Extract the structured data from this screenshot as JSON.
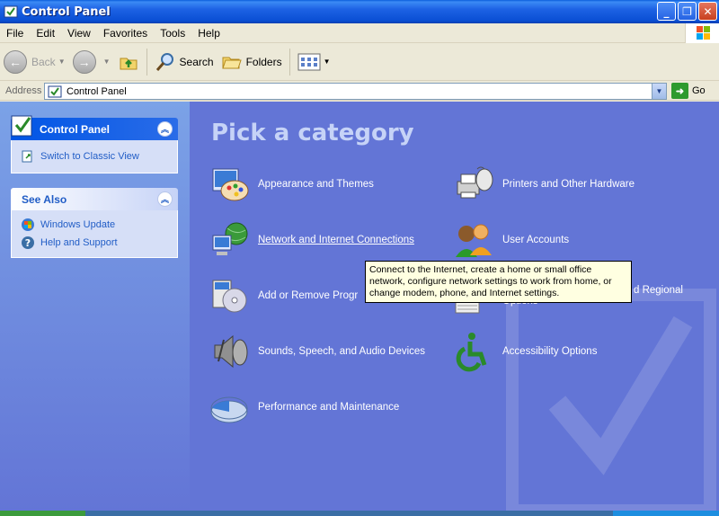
{
  "window": {
    "title": "Control Panel",
    "buttons": {
      "minimize": "_",
      "maximize": "❐",
      "close": "✕"
    }
  },
  "menubar": {
    "items": [
      "File",
      "Edit",
      "View",
      "Favorites",
      "Tools",
      "Help"
    ]
  },
  "toolbar": {
    "back_label": "Back",
    "search_label": "Search",
    "folders_label": "Folders"
  },
  "address": {
    "label": "Address",
    "value": "Control Panel",
    "go_label": "Go"
  },
  "sidebar": {
    "control_panel": {
      "title": "Control Panel",
      "items": [
        {
          "label": "Switch to Classic View",
          "icon": "switch-view-icon"
        }
      ]
    },
    "see_also": {
      "title": "See Also",
      "items": [
        {
          "label": "Windows Update",
          "icon": "windows-update-icon"
        },
        {
          "label": "Help and Support",
          "icon": "help-icon"
        }
      ]
    }
  },
  "main": {
    "title": "Pick a category",
    "categories": [
      {
        "label": "Appearance and Themes",
        "icon": "appearance-icon"
      },
      {
        "label": "Printers and Other Hardware",
        "icon": "printer-icon"
      },
      {
        "label": "Network and Internet Connections",
        "icon": "network-icon"
      },
      {
        "label": "User Accounts",
        "icon": "users-icon"
      },
      {
        "label": "Add or Remove Progr",
        "icon": "add-remove-icon"
      },
      {
        "label": "d Regional",
        "label2": "Options",
        "icon": "regional-icon"
      },
      {
        "label": "Sounds, Speech, and Audio Devices",
        "icon": "sounds-icon"
      },
      {
        "label": "Accessibility Options",
        "icon": "accessibility-icon"
      },
      {
        "label": "Performance and Maintenance",
        "icon": "performance-icon"
      }
    ],
    "tooltip": "Connect to the Internet, create a home or small office network, configure network settings to work from home, or change modem, phone, and Internet settings."
  },
  "colors": {
    "title_bar": "#0a4fd4",
    "main_bg": "#6375d6",
    "link": "#215dc6",
    "tooltip_bg": "#ffffe1"
  }
}
